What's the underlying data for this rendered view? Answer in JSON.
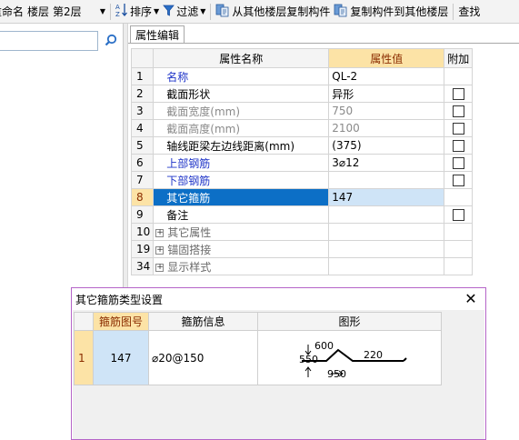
{
  "toolbar": {
    "rename_label": "重命名",
    "floor_label": "楼层",
    "floor_value": "第2层",
    "sort_label": "排序",
    "filter_label": "过滤",
    "copy_from_label": "从其他楼层复制构件",
    "copy_to_label": "复制构件到其他楼层",
    "find_label": "查找"
  },
  "left": {
    "search_placeholder": ""
  },
  "tab": {
    "label": "属性编辑"
  },
  "prop_table": {
    "headers": [
      "",
      "属性名称",
      "属性值",
      "附加"
    ],
    "rows": [
      {
        "no": "1",
        "name": "名称",
        "value": "QL-2",
        "style": "blue",
        "check": false
      },
      {
        "no": "2",
        "name": "截面形状",
        "value": "异形",
        "style": "normal",
        "check": true
      },
      {
        "no": "3",
        "name": "截面宽度(mm)",
        "value": "750",
        "style": "gray",
        "check": true
      },
      {
        "no": "4",
        "name": "截面高度(mm)",
        "value": "2100",
        "style": "gray",
        "check": true
      },
      {
        "no": "5",
        "name": "轴线距梁左边线距离(mm)",
        "value": "(375)",
        "style": "normal",
        "check": true
      },
      {
        "no": "6",
        "name": "上部钢筋",
        "value": "3⌀12",
        "style": "blue",
        "check": true
      },
      {
        "no": "7",
        "name": "下部钢筋",
        "value": "",
        "style": "blue",
        "check": true
      },
      {
        "no": "8",
        "name": "其它箍筋",
        "value": "147",
        "style": "selected",
        "check": false
      },
      {
        "no": "9",
        "name": "备注",
        "value": "",
        "style": "normal",
        "check": true
      },
      {
        "no": "10",
        "name": "其它属性",
        "value": "",
        "style": "group",
        "check": false
      },
      {
        "no": "19",
        "name": "锚固搭接",
        "value": "",
        "style": "group",
        "check": false
      },
      {
        "no": "34",
        "name": "显示样式",
        "value": "",
        "style": "group",
        "check": false
      }
    ]
  },
  "dialog": {
    "title": "其它箍筋类型设置",
    "headers": [
      "",
      "箍筋图号",
      "箍筋信息",
      "图形"
    ],
    "rows": [
      {
        "no": "1",
        "code": "147",
        "info": "⌀20@150"
      }
    ],
    "shape_labels": {
      "a": "600",
      "b": "550",
      "c": "220",
      "d": "950"
    }
  },
  "colors": {
    "selected_name_bg": "#0c6fc6",
    "selected_value_bg": "#cfe4f7",
    "header_highlight_bg": "#fce3a6",
    "dialog_border": "#b564c8",
    "label_blue": "#1f34c8"
  }
}
